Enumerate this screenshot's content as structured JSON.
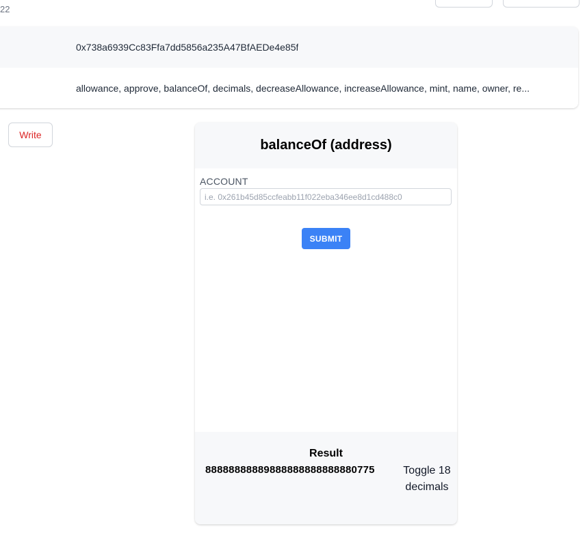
{
  "top": {
    "number": "22"
  },
  "info": {
    "address": "0x738a6939Cc83Ffa7dd5856a235A47BfAEDe4e85f",
    "methods": "allowance, approve, balanceOf, decimals, decreaseAllowance, increaseAllowance, mint, name, owner, re..."
  },
  "write_button_label": "Write",
  "function_card": {
    "title": "balanceOf (address)",
    "field_label": "ACCOUNT",
    "field_placeholder": "i.e. 0x261b45d85ccfeabb11f022eba346ee8d1cd488c0",
    "field_value": "",
    "submit_label": "SUBMIT",
    "result_title": "Result",
    "result_value": "88888888889888888888888880775",
    "toggle_label": "Toggle 18 decimals"
  },
  "colors": {
    "accent_blue": "#3b82f6",
    "write_red": "#dc2626",
    "panel_gray": "#f7f8fa"
  }
}
